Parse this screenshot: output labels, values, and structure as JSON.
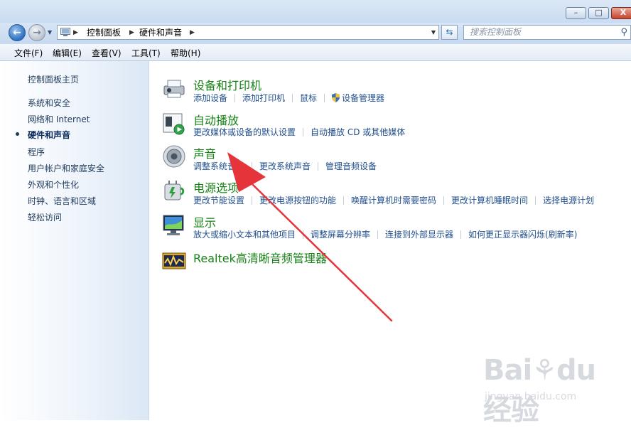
{
  "window": {
    "buttons": {
      "minimize": "–",
      "maximize": "□",
      "close": "X"
    }
  },
  "address_bar": {
    "breadcrumbs": [
      "控制面板",
      "硬件和声音"
    ],
    "search_placeholder": "搜索控制面板"
  },
  "menu": [
    "文件(F)",
    "编辑(E)",
    "查看(V)",
    "工具(T)",
    "帮助(H)"
  ],
  "sidebar": {
    "home": "控制面板主页",
    "items": [
      "系统和安全",
      "网络和 Internet",
      "硬件和声音",
      "程序",
      "用户帐户和家庭安全",
      "外观和个性化",
      "时钟、语言和区域",
      "轻松访问"
    ],
    "active_index": 2
  },
  "categories": [
    {
      "icon": "devices-printers-icon",
      "title": "设备和打印机",
      "links": [
        "添加设备",
        "添加打印机",
        "鼠标",
        "设备管理器"
      ]
    },
    {
      "icon": "autoplay-icon",
      "title": "自动播放",
      "links": [
        "更改媒体或设备的默认设置",
        "自动播放 CD 或其他媒体"
      ]
    },
    {
      "icon": "speaker-icon",
      "title": "声音",
      "links": [
        "调整系统音量",
        "更改系统声音",
        "管理音频设备"
      ]
    },
    {
      "icon": "power-options-icon",
      "title": "电源选项",
      "links": [
        "更改节能设置",
        "更改电源按钮的功能",
        "唤醒计算机时需要密码",
        "更改计算机睡眠时间",
        "选择电源计划"
      ]
    },
    {
      "icon": "display-icon",
      "title": "显示",
      "links": [
        "放大或缩小文本和其他项目",
        "调整屏幕分辨率",
        "连接到外部显示器",
        "如何更正显示器闪烁(刷新率)"
      ]
    },
    {
      "icon": "realtek-audio-icon",
      "title": "Realtek高清晰音频管理器",
      "links": []
    }
  ],
  "annotation": {
    "color": "#e5353b"
  },
  "watermark": {
    "brand": "Bai⚘du 经验",
    "url": "jingyan.baidu.com"
  },
  "colors": {
    "category_title": "#178217",
    "link": "#1f4e8c",
    "sidebar_text": "#1e395b"
  }
}
